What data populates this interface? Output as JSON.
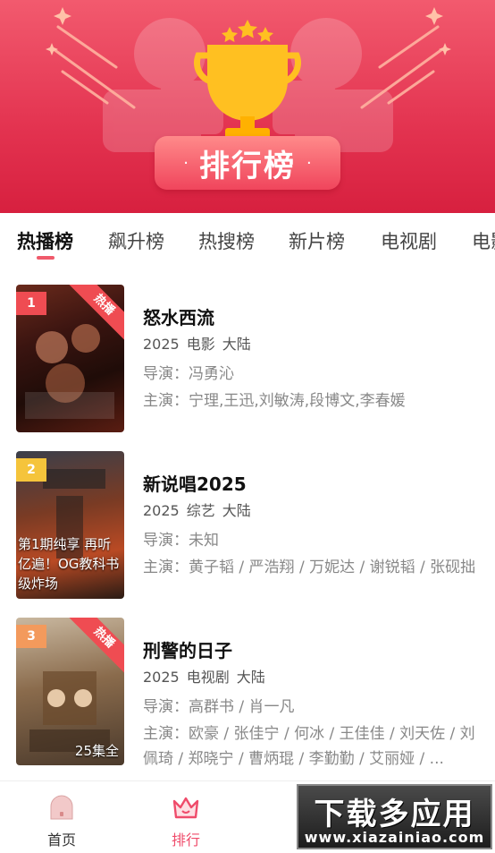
{
  "banner": {
    "title": "排行榜",
    "dot": "·"
  },
  "tabs": [
    {
      "label": "热播榜",
      "active": true
    },
    {
      "label": "飙升榜"
    },
    {
      "label": "热搜榜"
    },
    {
      "label": "新片榜"
    },
    {
      "label": "电视剧"
    },
    {
      "label": "电影"
    }
  ],
  "items": [
    {
      "rank": "1",
      "hot": "热播",
      "title": "怒水西流",
      "year": "2025",
      "genre": "电影",
      "region": "大陆",
      "director": "导演：冯勇沁",
      "cast": "主演：宁理,王迅,刘敏涛,段博文,李春媛",
      "poster_caption": "",
      "poster_badge": ""
    },
    {
      "rank": "2",
      "hot": "",
      "title": "新说唱2025",
      "year": "2025",
      "genre": "综艺",
      "region": "大陆",
      "director": "导演：未知",
      "cast": "主演：黄子韬 / 严浩翔 / 万妮达 / 谢锐韬 / 张砚拙",
      "poster_caption": "第1期纯享 再听亿遍！OG教科书级炸场",
      "poster_badge": ""
    },
    {
      "rank": "3",
      "hot": "热播",
      "title": "刑警的日子",
      "year": "2025",
      "genre": "电视剧",
      "region": "大陆",
      "director": "导演：高群书 / 肖一凡",
      "cast": "主演：欧豪 / 张佳宁 / 何冰 / 王佳佳 / 刘天佐 / 刘佩琦 / 郑晓宁 / 曹炳琨 / 李勤勤 / 艾丽娅 / ...",
      "poster_caption": "",
      "poster_badge": "25集全"
    }
  ],
  "nav": [
    {
      "label": "首页",
      "icon": "ghost-icon"
    },
    {
      "label": "排行",
      "icon": "crown-icon",
      "active": true
    }
  ],
  "watermark": {
    "main": "下载多应用",
    "sub": "www.xiazainiao.com"
  },
  "colors": {
    "accent": "#ef4c6b",
    "banner": "#e33350",
    "rank1": "#ef4c52",
    "rank2": "#f5c43b",
    "rank3": "#f39a5c"
  }
}
